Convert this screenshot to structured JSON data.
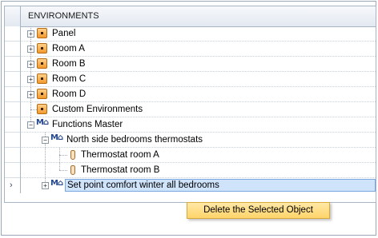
{
  "grid": {
    "header": "ENVIRONMENTS",
    "rows": [
      {
        "label": "Panel"
      },
      {
        "label": "Room A"
      },
      {
        "label": "Room B"
      },
      {
        "label": "Room C"
      },
      {
        "label": "Room D"
      },
      {
        "label": "Custom Environments"
      },
      {
        "label": "Functions Master"
      },
      {
        "label": "North side bedrooms thermostats"
      },
      {
        "label": "Thermostat room A"
      },
      {
        "label": "Thermostat room B"
      },
      {
        "label": "Set point comfort winter all bedrooms"
      }
    ]
  },
  "context_menu": {
    "item": "Delete the Selected Object"
  },
  "icons": {
    "environment": "environment-icon",
    "function": "function-master-icon",
    "thermostat": "thermostat-icon",
    "current_row": "row-pointer-icon"
  },
  "colors": {
    "selection": "#cfe3fb",
    "menu_bg": "#ffd56a",
    "env_icon": "#f29a2e"
  }
}
